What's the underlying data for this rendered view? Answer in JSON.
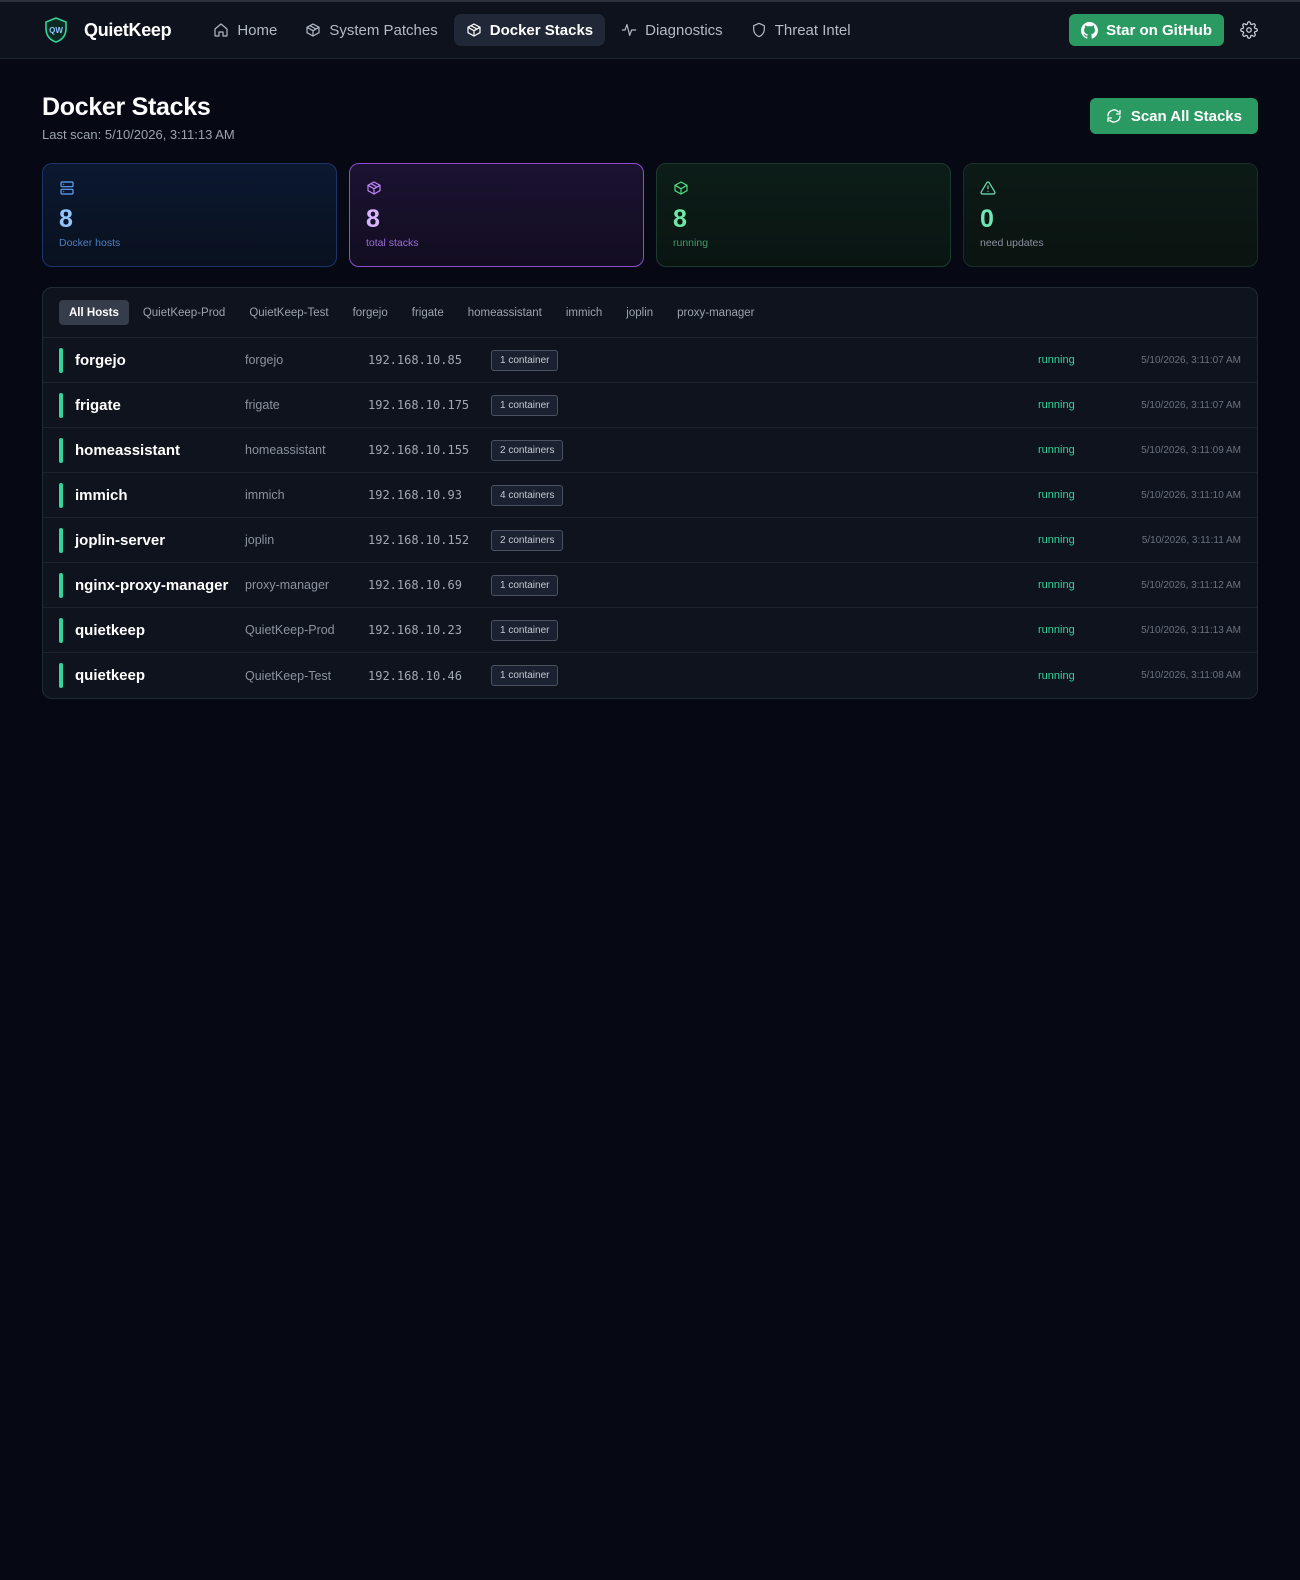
{
  "app": {
    "name": "QuietKeep",
    "logo_text": "QW"
  },
  "nav": {
    "items": [
      {
        "label": "Home",
        "icon": "home-icon"
      },
      {
        "label": "System Patches",
        "icon": "package-icon"
      },
      {
        "label": "Docker Stacks",
        "icon": "box-icon",
        "active": true
      },
      {
        "label": "Diagnostics",
        "icon": "activity-icon"
      },
      {
        "label": "Threat Intel",
        "icon": "shield-icon"
      }
    ],
    "github_label": "Star on GitHub"
  },
  "page": {
    "title": "Docker Stacks",
    "last_scan": "Last scan: 5/10/2026, 3:11:13 AM",
    "scan_button": "Scan All Stacks"
  },
  "stats": [
    {
      "value": "8",
      "label": "Docker hosts",
      "icon": "server-icon",
      "color": "#60a5fa"
    },
    {
      "value": "8",
      "label": "total stacks",
      "icon": "boxes-icon",
      "color": "#c084fc"
    },
    {
      "value": "8",
      "label": "running",
      "icon": "box-icon",
      "color": "#4ade80"
    },
    {
      "value": "0",
      "label": "need updates",
      "icon": "alert-triangle-icon",
      "color": "#6ee7b7"
    }
  ],
  "filters": [
    "All Hosts",
    "QuietKeep-Prod",
    "QuietKeep-Test",
    "forgejo",
    "frigate",
    "homeassistant",
    "immich",
    "joplin",
    "proxy-manager"
  ],
  "stacks": [
    {
      "name": "forgejo",
      "host": "forgejo",
      "ip": "192.168.10.85",
      "containers": "1 container",
      "status": "running",
      "time": "5/10/2026, 3:11:07 AM"
    },
    {
      "name": "frigate",
      "host": "frigate",
      "ip": "192.168.10.175",
      "containers": "1 container",
      "status": "running",
      "time": "5/10/2026, 3:11:07 AM"
    },
    {
      "name": "homeassistant",
      "host": "homeassistant",
      "ip": "192.168.10.155",
      "containers": "2 containers",
      "status": "running",
      "time": "5/10/2026, 3:11:09 AM"
    },
    {
      "name": "immich",
      "host": "immich",
      "ip": "192.168.10.93",
      "containers": "4 containers",
      "status": "running",
      "time": "5/10/2026, 3:11:10 AM"
    },
    {
      "name": "joplin-server",
      "host": "joplin",
      "ip": "192.168.10.152",
      "containers": "2 containers",
      "status": "running",
      "time": "5/10/2026, 3:11:11 AM"
    },
    {
      "name": "nginx-proxy-manager",
      "host": "proxy-manager",
      "ip": "192.168.10.69",
      "containers": "1 container",
      "status": "running",
      "time": "5/10/2026, 3:11:12 AM"
    },
    {
      "name": "quietkeep",
      "host": "QuietKeep-Prod",
      "ip": "192.168.10.23",
      "containers": "1 container",
      "status": "running",
      "time": "5/10/2026, 3:11:13 AM"
    },
    {
      "name": "quietkeep",
      "host": "QuietKeep-Test",
      "ip": "192.168.10.46",
      "containers": "1 container",
      "status": "running",
      "time": "5/10/2026, 3:11:08 AM"
    }
  ]
}
